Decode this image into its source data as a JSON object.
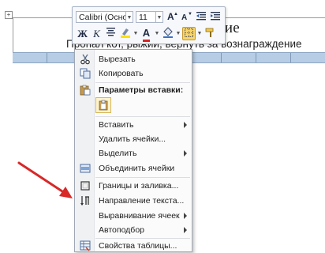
{
  "document": {
    "table_anchor_glyph": "+",
    "title_visible": "дание",
    "body_line": "Пропал кот, рыжий, вернуть за вознаграждение"
  },
  "mini_toolbar": {
    "font_name": "Calibri (Основ",
    "font_size": "11",
    "grow_font_glyph": "A",
    "shrink_font_glyph": "A",
    "bold_label": "Ж",
    "italic_label": "К",
    "font_color_label": "A"
  },
  "context_menu": {
    "items": [
      {
        "label": "Вырезать",
        "icon": "scissors-icon"
      },
      {
        "label": "Копировать",
        "icon": "copy-icon"
      },
      {
        "label": "Параметры вставки:",
        "icon": "paste-icon"
      },
      {
        "label": "Вставить",
        "icon": "none",
        "submenu": true
      },
      {
        "label": "Удалить ячейки...",
        "icon": "none"
      },
      {
        "label": "Выделить",
        "icon": "none",
        "submenu": true
      },
      {
        "label": "Объединить ячейки",
        "icon": "merge-cells-icon"
      },
      {
        "label": "Границы и заливка...",
        "icon": "borders-icon"
      },
      {
        "label": "Направление текста...",
        "icon": "text-direction-icon"
      },
      {
        "label": "Выравнивание ячеек",
        "icon": "none",
        "submenu": true
      },
      {
        "label": "Автоподбор",
        "icon": "none",
        "submenu": true
      },
      {
        "label": "Свойства таблицы...",
        "icon": "table-properties-icon"
      }
    ]
  },
  "colors": {
    "annotation_arrow": "#d82828",
    "selection_fill": "#b7cde6",
    "highlight": "#f8d56b"
  }
}
